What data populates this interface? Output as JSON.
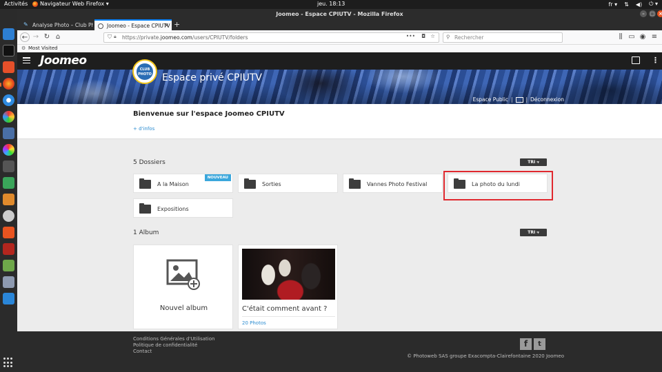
{
  "os": {
    "activities": "Activités",
    "app_menu": "Navigateur Web Firefox ▾",
    "clock": "jeu. 18:13",
    "lang": "fr ▾"
  },
  "browser": {
    "window_title": "Joomeo - Espace CPIUTV - Mozilla Firefox",
    "tabs": [
      {
        "label": "Analyse Photo – Club Ph"
      },
      {
        "label": "Joomeo - Espace CPIUTV"
      }
    ],
    "url_prefix": "https://private.",
    "url_domain": "joomeo.com",
    "url_path": "/users/CPIUTV/folders",
    "search_placeholder": "Rechercher",
    "bookmark": "Most Visited"
  },
  "site": {
    "logo": "Joomeo",
    "club_logo_text": "CLUB PHOTO",
    "space_title": "Espace privé CPIUTV",
    "public_space": "Espace Public",
    "logout": "Déconnexion",
    "welcome": "Bienvenue sur l'espace Joomeo CPIUTV",
    "more_info": "+ d'infos"
  },
  "folders": {
    "title": "5 Dossiers",
    "sort_label": "TRI",
    "items": [
      {
        "label": "A la Maison",
        "badge": "NOUVEAU"
      },
      {
        "label": "Sorties"
      },
      {
        "label": "Vannes Photo Festival"
      },
      {
        "label": "La photo du lundi"
      },
      {
        "label": "Expositions"
      }
    ]
  },
  "albums": {
    "title": "1 Album",
    "sort_label": "TRI",
    "new_album": "Nouvel album",
    "items": [
      {
        "title": "C'était comment avant ?",
        "count": "20 Photos"
      }
    ]
  },
  "footer": {
    "links": [
      "Conditions Générales d'Utilisation",
      "Politique de confidentialité",
      "Contact"
    ],
    "copyright": "© Photoweb SAS groupe Exacompta-Clairefontaine 2020 Joomeo"
  },
  "colors": {
    "accent_blue": "#2b8cd1",
    "badge_blue": "#3ba7dc",
    "highlight_red": "#e0282e",
    "header_dark": "#1e1e1e"
  }
}
